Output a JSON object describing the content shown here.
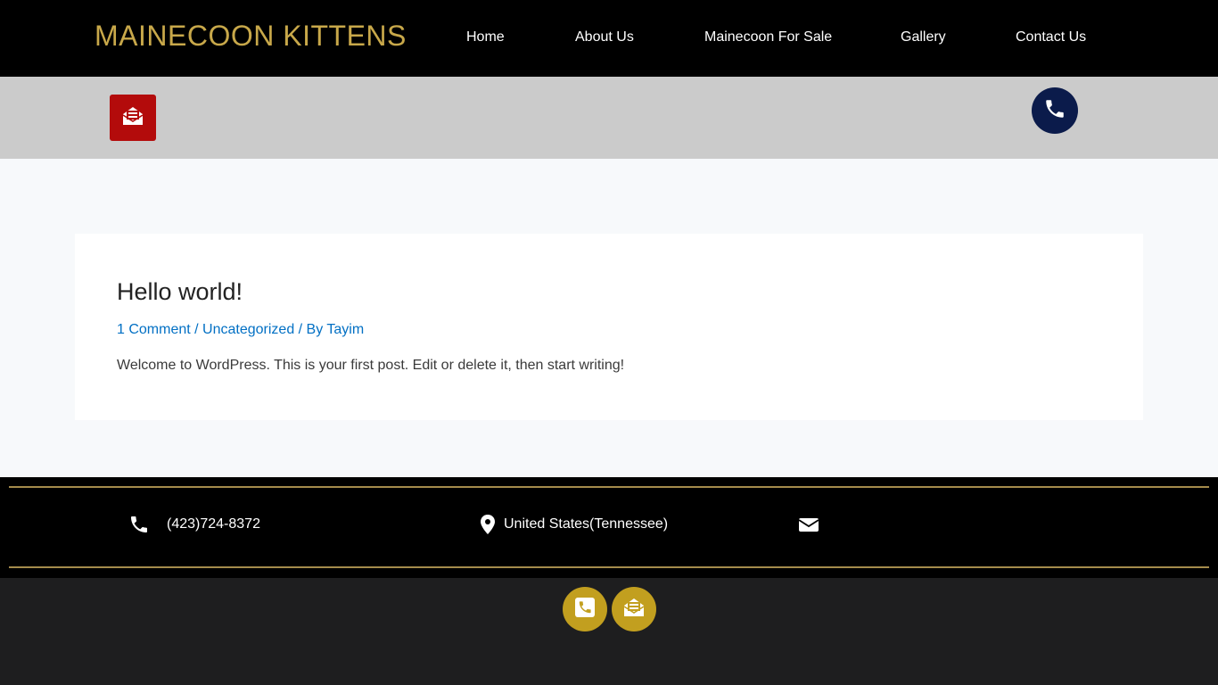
{
  "header": {
    "site_title": "MAINECOON KITTENS",
    "nav": [
      {
        "label": "Home"
      },
      {
        "label": "About Us"
      },
      {
        "label": "Mainecoon For Sale"
      },
      {
        "label": "Gallery"
      },
      {
        "label": "Contact Us"
      }
    ]
  },
  "contact_bar": {
    "envelope_icon": "envelope-open-text-icon",
    "phone_icon": "phone-icon"
  },
  "post": {
    "title": "Hello world!",
    "meta": {
      "comments": "1 Comment",
      "separator1": " / ",
      "category": "Uncategorized",
      "separator2": " / By ",
      "author": "Tayim"
    },
    "excerpt": "Welcome to WordPress. This is your first post. Edit or delete it, then start writing!"
  },
  "footer_info": {
    "phone": "(423)724-8372",
    "location": "United States(Tennessee)",
    "email_icon": "envelope-icon"
  },
  "footer_bottom": {
    "buttons": [
      "phone-square-icon",
      "envelope-open-text-icon"
    ]
  },
  "colors": {
    "header_bg": "#000000",
    "brand_gold": "#c8a84a",
    "bar_grey": "#cbcbcb",
    "envelope_red": "#b30b0b",
    "phone_navy": "#0b1b4b",
    "link_blue": "#0270c4",
    "footer_gold": "#c29f1f",
    "footer_bottom_bg": "#1e1e1f"
  }
}
